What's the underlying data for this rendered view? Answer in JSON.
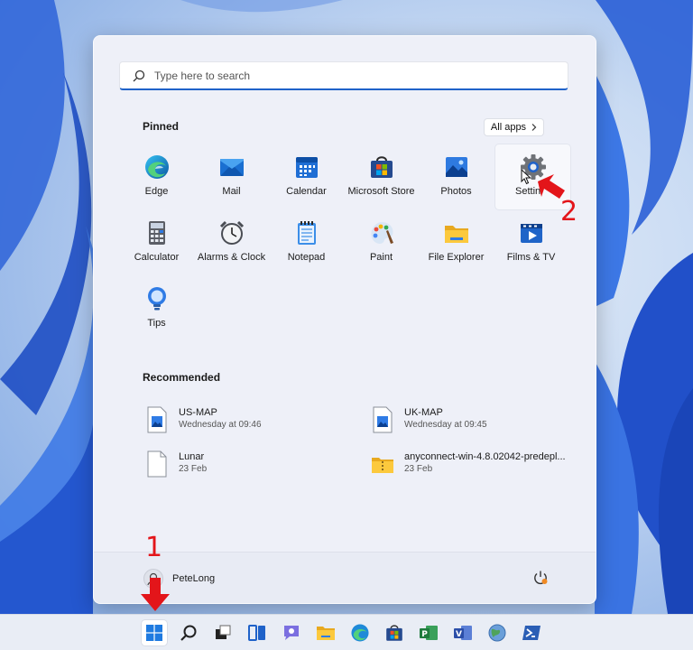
{
  "search": {
    "placeholder": "Type here to search"
  },
  "pinned": {
    "title": "Pinned",
    "all_apps_label": "All apps",
    "apps": [
      {
        "label": "Edge",
        "icon": "edge-icon"
      },
      {
        "label": "Mail",
        "icon": "mail-icon"
      },
      {
        "label": "Calendar",
        "icon": "calendar-icon"
      },
      {
        "label": "Microsoft Store",
        "icon": "store-icon"
      },
      {
        "label": "Photos",
        "icon": "photos-icon"
      },
      {
        "label": "Settin",
        "icon": "gear-icon"
      },
      {
        "label": "Calculator",
        "icon": "calculator-icon"
      },
      {
        "label": "Alarms & Clock",
        "icon": "clock-icon"
      },
      {
        "label": "Notepad",
        "icon": "notepad-icon"
      },
      {
        "label": "Paint",
        "icon": "paint-icon"
      },
      {
        "label": "File Explorer",
        "icon": "folder-icon"
      },
      {
        "label": "Films & TV",
        "icon": "films-icon"
      },
      {
        "label": "Tips",
        "icon": "tips-icon"
      }
    ]
  },
  "recommended": {
    "title": "Recommended",
    "items": [
      {
        "name": "US-MAP",
        "time": "Wednesday at 09:46",
        "icon": "image-file-icon"
      },
      {
        "name": "UK-MAP",
        "time": "Wednesday at 09:45",
        "icon": "image-file-icon"
      },
      {
        "name": "Lunar",
        "time": "23 Feb",
        "icon": "blank-file-icon"
      },
      {
        "name": "anyconnect-win-4.8.02042-predepl...",
        "time": "23 Feb",
        "icon": "zip-folder-icon"
      }
    ]
  },
  "user": {
    "name": "PeteLong"
  },
  "annotations": {
    "step1": "1",
    "step2": "2"
  },
  "colors": {
    "accent": "#1f62c9",
    "annotation": "#e3151a"
  }
}
